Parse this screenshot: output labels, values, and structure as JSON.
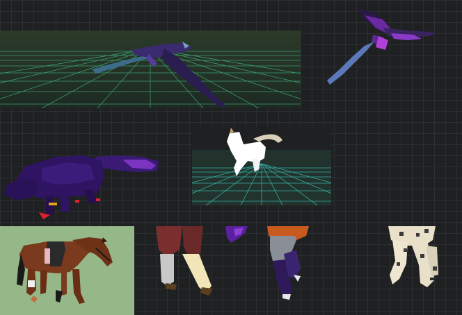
{
  "viewport": {
    "background": "#1f2022",
    "grid_line_color": "#2c2e31"
  },
  "previews": [
    {
      "id": "purple-dragon-ground",
      "icon": "dragon-icon",
      "grid_color": "#3fae7e"
    },
    {
      "id": "purple-dragon-flying",
      "icon": "dragon-icon"
    },
    {
      "id": "purple-wolf",
      "icon": "wolf-icon"
    },
    {
      "id": "white-cat",
      "icon": "cat-icon",
      "grid_color": "#39c0b4"
    },
    {
      "id": "brown-horse",
      "icon": "horse-icon",
      "panel_color": "#96b888"
    },
    {
      "id": "red-legs",
      "icon": "legs-icon"
    },
    {
      "id": "purple-fragment",
      "icon": "fragment-icon"
    },
    {
      "id": "orange-grey-legs",
      "icon": "legs-icon"
    },
    {
      "id": "spotted-legs",
      "icon": "legs-icon"
    }
  ]
}
